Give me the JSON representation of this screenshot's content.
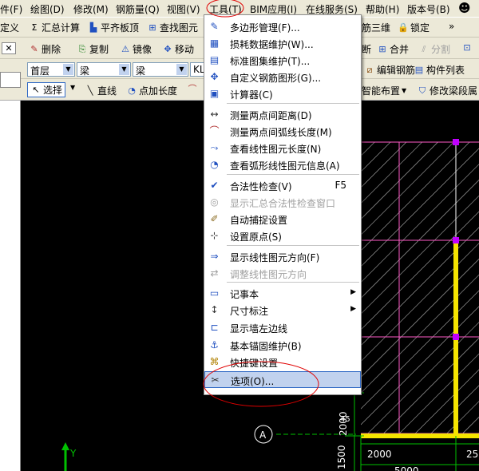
{
  "colors": {
    "accent": "#316ac5",
    "highlight": "#c1d2ee",
    "canvas": "#000000",
    "annotation": "#e00000"
  },
  "menubar": {
    "items": [
      "件(F)",
      "绘图(D)",
      "修改(M)",
      "钢筋量(Q)",
      "视图(V)",
      "工具(T)",
      "BIM应用(I)",
      "在线服务(S)",
      "帮助(H)",
      "版本号(B)"
    ]
  },
  "toolbar1": {
    "define": "定义",
    "sum_calc": "汇总计算",
    "level_slab": "平齐板顶",
    "find_elem": "查找图元",
    "rebar3d": "筋三维",
    "lock": "锁定"
  },
  "toolbar2": {
    "delete": "删除",
    "copy": "复制",
    "mirror": "镜像",
    "move": "移动",
    "new_prefix": "断",
    "merge": "合并",
    "split": "分割"
  },
  "toolbar3": {
    "floor": "首层",
    "type1": "梁",
    "type2": "梁",
    "name": "KL",
    "edit_rebar": "编辑钢筋",
    "component_list": "构件列表"
  },
  "toolbar4": {
    "select": "选择",
    "line": "直线",
    "point_len": "点加长度",
    "smart_layout": "智能布置",
    "modify_span": "修改梁段属"
  },
  "tools_menu": [
    {
      "label": "多边形管理(F)...",
      "icon": "polygon-icon",
      "glyph": "✎"
    },
    {
      "label": "损耗数据维护(W)...",
      "icon": "table-icon",
      "glyph": "▦"
    },
    {
      "label": "标准图集维护(T)...",
      "icon": "atlas-icon",
      "glyph": "▤"
    },
    {
      "label": "自定义钢筋图形(G)...",
      "icon": "custom-rebar-icon",
      "glyph": "✥"
    },
    {
      "label": "计算器(C)",
      "icon": "calculator-icon",
      "glyph": "▣"
    },
    {
      "label": "测量两点间距离(D)",
      "icon": "measure-distance-icon",
      "glyph": "↔"
    },
    {
      "label": "测量两点间弧线长度(M)",
      "icon": "measure-arc-icon",
      "glyph": "⌒"
    },
    {
      "label": "查看线性图元长度(N)",
      "icon": "line-length-icon",
      "glyph": "⤳"
    },
    {
      "label": "查看弧形线性图元信息(A)",
      "icon": "arc-info-icon",
      "glyph": "◔"
    },
    {
      "label": "合法性检查(V)",
      "shortcut": "F5",
      "icon": "check-icon",
      "glyph": "✔"
    },
    {
      "label": "显示汇总合法性检查窗口",
      "icon": "check-window-icon",
      "glyph": "◎"
    },
    {
      "label": "自动捕捉设置",
      "icon": "snap-icon",
      "glyph": "✐"
    },
    {
      "label": "设置原点(S)",
      "icon": "origin-icon",
      "glyph": "⊹"
    },
    {
      "label": "显示线性图元方向(F)",
      "icon": "direction-icon",
      "glyph": "⇒"
    },
    {
      "label": "调整线性图元方向",
      "icon": "adjust-direction-icon",
      "glyph": "⇄"
    },
    {
      "label": "记事本",
      "icon": "notepad-icon",
      "glyph": "▭"
    },
    {
      "label": "尺寸标注",
      "icon": "dimension-icon",
      "glyph": "↕"
    },
    {
      "label": "显示墙左边线",
      "icon": "wall-edge-icon",
      "glyph": "⊏"
    },
    {
      "label": "基本锚固维护(B)",
      "icon": "anchor-icon",
      "glyph": "⚓"
    },
    {
      "label": "快捷键设置",
      "icon": "shortcut-icon",
      "glyph": "⌘"
    },
    {
      "label": "选项(O)...",
      "icon": "options-icon",
      "glyph": "✂"
    }
  ],
  "canvas": {
    "axis_label": "A",
    "dim_vertical_1": "1500",
    "dim_vertical_2": "2000",
    "dim_horizontal_1": "2000",
    "dim_horizontal_2": "5000",
    "dim_horizontal_3": "25",
    "dim_partial": "45",
    "y_label": "Y"
  }
}
